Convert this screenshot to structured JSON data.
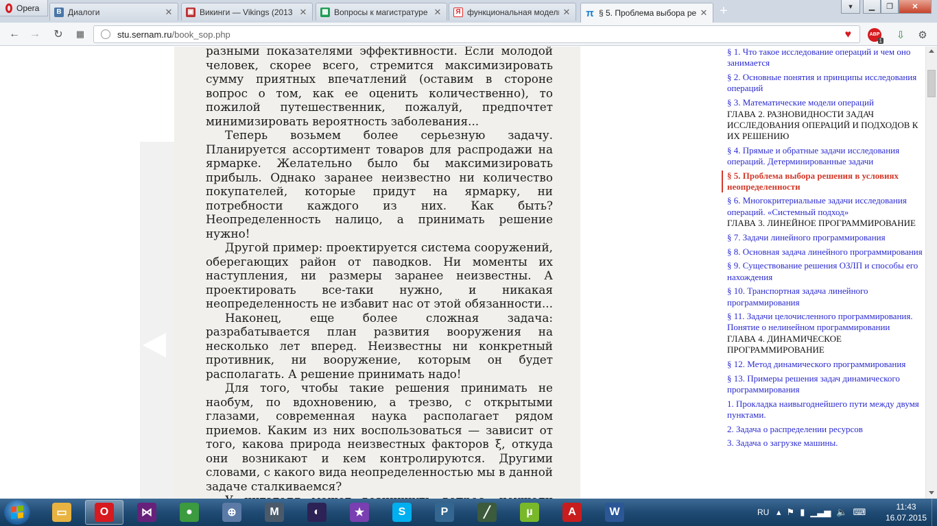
{
  "browser": {
    "menu_label": "Opera",
    "tabs": [
      {
        "label": "Диалоги",
        "icon": "vk-icon",
        "color": "#4a76a8",
        "glyph": "В"
      },
      {
        "label": "Викинги — Vikings (2013",
        "icon": "tv-icon",
        "color": "#b33",
        "glyph": "▣"
      },
      {
        "label": "Вопросы к магистратуре",
        "icon": "sheets-icon",
        "color": "#1f9d55",
        "glyph": "▦"
      },
      {
        "label": "функциональная модель",
        "icon": "yandex-icon",
        "color": "#e02a2a",
        "glyph": "Я"
      },
      {
        "label": "§ 5. Проблема выбора ре",
        "icon": "pi-icon",
        "color": "#1a7fd0",
        "glyph": "π"
      }
    ],
    "url_host": "stu.sernam.ru",
    "url_path": "/book_sop.php",
    "adblock_badge": "ABP",
    "adblock_count": "1"
  },
  "book": {
    "paragraphs": [
      {
        "cont": true,
        "text": "разными показателями эффективности. Если молодой человек, скорее всего, стремится максимизировать сумму приятных впечатлений (оставим в стороне вопрос о том, как ее оценить количественно), то пожилой путешественник, пожалуй, предпочтет минимизировать вероятность заболевания..."
      },
      {
        "cont": false,
        "text": "Теперь возьмем более серьезную задачу. Планируется ассортимент товаров для распродажи на ярмарке. Желательно было бы максимизировать прибыль. Однако заранее неизвестно ни количество покупателей, которые придут на ярмарку, ни потребности каждого из них. Как быть? Неопределенность налицо, а принимать решение нужно!"
      },
      {
        "cont": false,
        "text": "Другой пример: проектируется система сооружений, оберегающих район от паводков. Ни моменты их наступления, ни размеры заранее неизвестны. А проектировать все-таки нужно, и никакая неопределенность не избавит нас от этой обязанности..."
      },
      {
        "cont": false,
        "text": "Наконец, еще более сложная задача: разрабатывается план развития вооружения на несколько лет вперед. Неизвестны ни конкретный противник, ни вооружение, которым он будет располагать. А решение принимать надо!"
      },
      {
        "cont": false,
        "text": "Для того, чтобы такие решения принимать не наобум, по вдохновению, а трезво, с открытыми глазами, современная наука располагает рядом приемов. Каким из них воспользоваться — зависит от того, какова природа неизвестных факторов ξ, откуда они возникают и кем контролируются. Другими словами, с какого вида неопределенностью мы в данной задаче сталкиваемся?"
      },
      {
        "cont": false,
        "text": "У читателя может возникнуть вопрос: неужели можно классифицировать неопределенности по «родам» и «сортам»? Оказывается, можно."
      }
    ]
  },
  "toc": [
    {
      "type": "link",
      "text": "§ 1. Что такое исследование операций и чем оно занимается"
    },
    {
      "type": "link",
      "text": "§ 2. Основные понятия и принципы исследования операций"
    },
    {
      "type": "link",
      "text": "§ 3. Математические модели операций"
    },
    {
      "type": "heading",
      "text": "ГЛАВА 2. РАЗНОВИДНОСТИ ЗАДАЧ ИССЛЕДОВАНИЯ ОПЕРАЦИЙ И ПОДХОДОВ К ИХ РЕШЕНИЮ"
    },
    {
      "type": "link",
      "text": "§ 4. Прямые и обратные задачи исследования операций. Детерминированные задачи"
    },
    {
      "type": "current",
      "text": "§ 5. Проблема выбора решения в условиях неопределенности"
    },
    {
      "type": "link",
      "text": "§ 6. Многокритериальные задачи исследования операций. «Системный подход»"
    },
    {
      "type": "heading",
      "text": "ГЛАВА 3. ЛИНЕЙНОЕ ПРОГРАММИРОВАНИЕ"
    },
    {
      "type": "link",
      "text": "§ 7. Задачи линейного программирования"
    },
    {
      "type": "link",
      "text": "§ 8. Основная задача линейного программирования"
    },
    {
      "type": "link",
      "text": "§ 9. Существование решения ОЗЛП и способы его нахождения"
    },
    {
      "type": "link",
      "text": "§ 10. Транспортная задача линейного программирования"
    },
    {
      "type": "link",
      "text": "§ 11. Задачи целочисленного программирования. Понятие о нелинейном программировании"
    },
    {
      "type": "heading",
      "text": "ГЛАВА 4. ДИНАМИЧЕСКОЕ ПРОГРАММИРОВАНИЕ"
    },
    {
      "type": "link",
      "text": "§ 12. Метод динамического программирования"
    },
    {
      "type": "link",
      "text": "§ 13. Примеры решения задач динамического программирования"
    },
    {
      "type": "link",
      "text": "1. Прокладка наивыгоднейшего пути между двумя пунктами."
    },
    {
      "type": "link",
      "text": "2. Задача о распределении ресурсов"
    },
    {
      "type": "link",
      "text": "3. Задача о загрузке машины."
    }
  ],
  "taskbar": {
    "apps": [
      {
        "name": "explorer-app",
        "icon": "folder-icon",
        "color": "#e8b341",
        "glyph": "▭"
      },
      {
        "name": "opera-app",
        "icon": "opera-icon",
        "color": "#d61a1f",
        "glyph": "O"
      },
      {
        "name": "visual-studio-app",
        "icon": "visual-studio-icon",
        "color": "#68217a",
        "glyph": "⋈"
      },
      {
        "name": "chrome-app",
        "icon": "chrome-icon",
        "color": "#3c9a3f",
        "glyph": "●"
      },
      {
        "name": "network-tool-app",
        "icon": "satellite-icon",
        "color": "#5b7aa6",
        "glyph": "⊕"
      },
      {
        "name": "m-app",
        "icon": "m-icon",
        "color": "#4a5a6a",
        "glyph": "M"
      },
      {
        "name": "eclipse-app",
        "icon": "eclipse-icon",
        "color": "#2c2255",
        "glyph": "◐"
      },
      {
        "name": "star-app",
        "icon": "star-icon",
        "color": "#7a3fb0",
        "glyph": "★"
      },
      {
        "name": "skype-app",
        "icon": "skype-icon",
        "color": "#00aff0",
        "glyph": "S"
      },
      {
        "name": "postgres-app",
        "icon": "elephant-icon",
        "color": "#336791",
        "glyph": "P"
      },
      {
        "name": "chart-app",
        "icon": "chart-icon",
        "color": "#3c5a3c",
        "glyph": "╱"
      },
      {
        "name": "utorrent-app",
        "icon": "utorrent-icon",
        "color": "#79b829",
        "glyph": "µ"
      },
      {
        "name": "acrobat-app",
        "icon": "pdf-icon",
        "color": "#c91d1d",
        "glyph": "A"
      },
      {
        "name": "word-app",
        "icon": "word-icon",
        "color": "#2b5797",
        "glyph": "W"
      }
    ],
    "language": "RU",
    "time": "11:43",
    "date": "16.07.2015"
  }
}
